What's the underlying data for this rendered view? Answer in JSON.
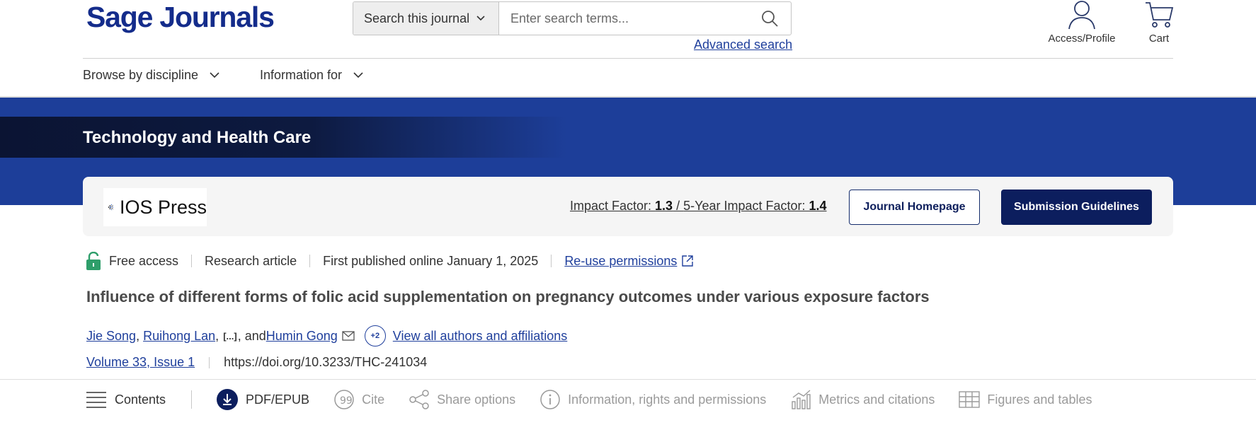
{
  "header": {
    "logo_text": "Sage Journals",
    "search": {
      "scope_label": "Search this journal",
      "placeholder": "Enter search terms...",
      "advanced_label": "Advanced search"
    },
    "access_label": "Access/Profile",
    "cart_label": "Cart"
  },
  "nav": {
    "items": [
      {
        "label": "Browse by discipline"
      },
      {
        "label": "Information for"
      }
    ]
  },
  "banner": {
    "journal_name": "Technology and Health Care"
  },
  "journal_card": {
    "publisher_logo_text": "IOS Press",
    "impact_factor_label": "Impact Factor: ",
    "impact_factor_value": "1.3",
    "impact_separator": " / ",
    "five_year_label": "5-Year Impact Factor: ",
    "five_year_value": "1.4",
    "homepage_button": "Journal Homepage",
    "submission_button": "Submission Guidelines"
  },
  "article": {
    "access": "Free access",
    "type": "Research article",
    "published": "First published online January 1, 2025",
    "reuse_label": "Re-use permissions",
    "title": "Influence of different forms of folic acid supplementation on pregnancy outcomes under various exposure factors",
    "authors": {
      "first": "Jie Song",
      "second": "Ruihong Lan",
      "ellipsis": "[...]",
      "and_text": ", and ",
      "last": "Humin Gong",
      "more_count": "+2",
      "view_all_label": "View all authors and affiliations"
    },
    "volume_issue": "Volume 33, Issue 1",
    "doi": "https://doi.org/10.3233/THC-241034"
  },
  "toolbar": {
    "items": [
      {
        "label": "Contents",
        "icon": "list-icon"
      },
      {
        "label": "PDF/EPUB",
        "icon": "download-icon"
      },
      {
        "label": "Cite",
        "icon": "quote-icon"
      },
      {
        "label": "Share options",
        "icon": "share-icon"
      },
      {
        "label": "Information, rights and permissions",
        "icon": "info-icon"
      },
      {
        "label": "Metrics and citations",
        "icon": "bar-chart-icon"
      },
      {
        "label": "Figures and tables",
        "icon": "table-icon"
      }
    ]
  },
  "colors": {
    "brand_navy": "#142c8b",
    "banner_blue": "#1d3e99",
    "link_blue": "#1f3f9c",
    "button_dark": "#0c1e5e",
    "lock_green": "#2e9e6a"
  }
}
